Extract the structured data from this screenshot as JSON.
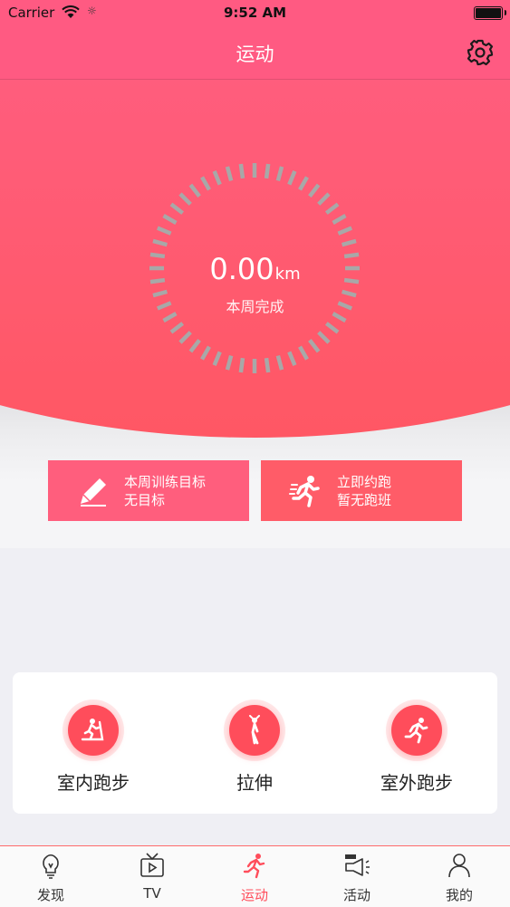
{
  "status_bar": {
    "carrier": "Carrier",
    "time": "9:52 AM"
  },
  "nav": {
    "title": "运动",
    "settings_icon": "gear-icon"
  },
  "weekly": {
    "distance": "0.00",
    "unit": "km",
    "label": "本周完成",
    "progress": 0
  },
  "cards": {
    "goal": {
      "title": "本周训练目标",
      "subtitle": "无目标",
      "icon": "pencil-icon"
    },
    "run": {
      "title": "立即约跑",
      "subtitle": "暂无跑班",
      "icon": "runner-icon"
    }
  },
  "modes": [
    {
      "label": "室内跑步",
      "icon": "treadmill-icon"
    },
    {
      "label": "拉伸",
      "icon": "stretch-icon"
    },
    {
      "label": "室外跑步",
      "icon": "outdoor-run-icon"
    }
  ],
  "tabs": [
    {
      "label": "发现",
      "icon": "lightbulb-icon"
    },
    {
      "label": "TV",
      "icon": "tv-icon"
    },
    {
      "label": "运动",
      "icon": "running-icon",
      "active": true
    },
    {
      "label": "活动",
      "icon": "megaphone-icon"
    },
    {
      "label": "我的",
      "icon": "person-icon"
    }
  ],
  "colors": {
    "primary": "#ff5a82",
    "accent": "#ff4d5b",
    "tick": "#a8a8a8"
  }
}
